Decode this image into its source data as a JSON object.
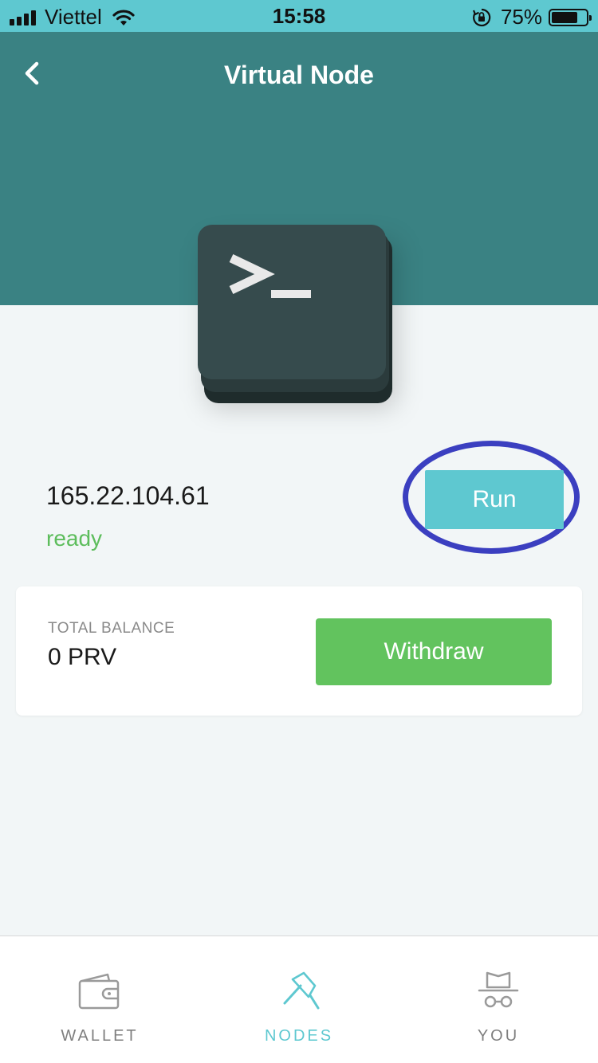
{
  "status_bar": {
    "carrier": "Viettel",
    "time": "15:58",
    "battery_percent": "75%",
    "battery_level": 0.75,
    "signal_bars": 4
  },
  "header": {
    "title": "Virtual Node",
    "back_icon": "chevron-left-icon"
  },
  "node": {
    "icon": "terminal-icon",
    "terminal_glyph": ">_",
    "ip": "165.22.104.61",
    "status": "ready",
    "run_label": "Run"
  },
  "balance": {
    "label": "TOTAL BALANCE",
    "value": "0 PRV",
    "withdraw_label": "Withdraw"
  },
  "tabs": [
    {
      "label": "WALLET",
      "icon": "wallet-icon",
      "active": false
    },
    {
      "label": "NODES",
      "icon": "pickaxe-icon",
      "active": true
    },
    {
      "label": "YOU",
      "icon": "incognito-icon",
      "active": false
    }
  ],
  "colors": {
    "status_bar": "#5ec8d0",
    "header": "#3a8283",
    "accent": "#5ec8d0",
    "ready": "#5dbd5c",
    "withdraw": "#62c35e",
    "highlight": "#3b3fc0",
    "background": "#f2f6f7"
  }
}
